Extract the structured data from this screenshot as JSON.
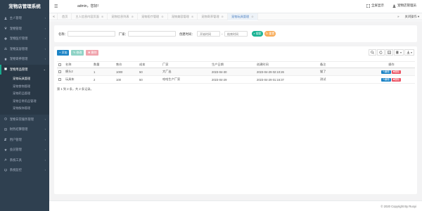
{
  "app": {
    "brand": "宠物店管理系统"
  },
  "header": {
    "admin": "admin，您好!",
    "fullscreen_label": "全屏显示",
    "petshop_label": "宠物店管理员"
  },
  "sidebar": {
    "items": [
      {
        "label": "主人管理",
        "icon": "user-icon"
      },
      {
        "label": "宠物管理",
        "icon": "paw-icon"
      },
      {
        "label": "宠物医疗管理",
        "icon": "medical-icon"
      },
      {
        "label": "宠物美容管理",
        "icon": "scissors-icon"
      },
      {
        "label": "宠物寄养管理",
        "icon": "home-icon"
      },
      {
        "label": "宠物用品管理",
        "icon": "box-icon",
        "active": true
      }
    ],
    "submenu": [
      "宠物玩具管理",
      "宠物食物管理",
      "宠物药品管理",
      "宠物日常用品管理",
      "宠物服饰管理"
    ],
    "items_after": [
      {
        "label": "宠物日常服务管理",
        "icon": "service-icon"
      },
      {
        "label": "财务结算管理",
        "icon": "finance-icon"
      },
      {
        "label": "用户管理",
        "icon": "users-icon"
      },
      {
        "label": "会员管理",
        "icon": "member-icon"
      },
      {
        "label": "系统工具",
        "icon": "tools-icon"
      },
      {
        "label": "系统监控",
        "icon": "monitor-icon"
      }
    ]
  },
  "tabbar": {
    "tabs": [
      {
        "label": "首页",
        "closable": false
      },
      {
        "label": "主人信息内容页面",
        "closable": true
      },
      {
        "label": "宠物信息列表",
        "closable": true
      },
      {
        "label": "宠物医疗管理",
        "closable": true
      },
      {
        "label": "宠物美容管理",
        "closable": true
      },
      {
        "label": "宠物寄养管理",
        "closable": true
      },
      {
        "label": "宠物玩具管理",
        "closable": true,
        "active": true
      }
    ],
    "tools": {
      "close_label": "关闭操作",
      "more_label": "»"
    }
  },
  "search": {
    "name_label": "名称：",
    "maker_label": "厂家：",
    "created_label": "创建时间：",
    "start_placeholder": "开始时间",
    "end_placeholder": "结束时间",
    "search_btn": "搜索",
    "reset_btn": "重置"
  },
  "toolbar": {
    "add": "+ 添加",
    "edit": "✎ 修改",
    "delete": "✖ 删除"
  },
  "table": {
    "columns": [
      "名称",
      "数量",
      "售价",
      "成本",
      "厂家",
      "生产日期",
      "创建时间",
      "备注",
      "操作"
    ],
    "rows": [
      {
        "name": "棉头2",
        "qty": "1",
        "price": "1000",
        "cost": "50",
        "maker": "大厂出",
        "date": "2023-04-30",
        "created": "2023-04-29 02:10:26",
        "note": "猫了"
      },
      {
        "name": "玩具车",
        "qty": "2",
        "price": "100",
        "cost": "50",
        "maker": "哈哈生产厂家",
        "date": "2023-04-29",
        "created": "2023-04-29 01:16:37",
        "note": "测试"
      }
    ],
    "edit_label": "✎编辑",
    "delete_label": "✖删除",
    "pager": "第 1 到 2 条，共 2 条记录。"
  },
  "footer": {
    "copyright": "© 2020 Copyright By Ruoyi"
  },
  "colors": {
    "sidebar": "#2f4050",
    "primary": "#1c84c6",
    "success": "#1ab394",
    "warning": "#f8ac59",
    "danger": "#ed5565"
  }
}
